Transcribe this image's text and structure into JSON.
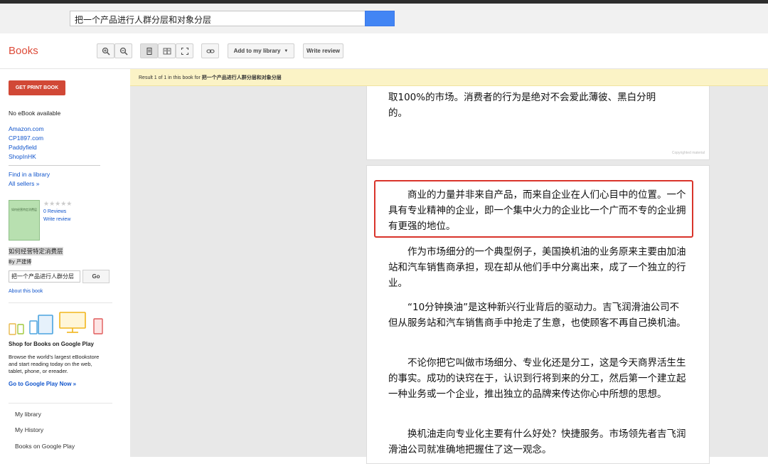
{
  "search": {
    "query": "把一个产品进行人群分层和对象分层"
  },
  "toolbar": {
    "logo": "Books",
    "add_library": "Add to my library",
    "write_review": "Write review"
  },
  "sidebar": {
    "print_button": "GET PRINT BOOK",
    "no_ebook": "No eBook available",
    "sellers": [
      "Amazon.com",
      "CP1897.com",
      "Paddyfield",
      "ShopInHK"
    ],
    "find_library": "Find in a library",
    "all_sellers": "All sellers »",
    "stars": "★★★★★",
    "reviews": "0 Reviews",
    "write_review": "Write review",
    "book_title": "如何经营特定消费层",
    "author": "By 严建博",
    "cover_text": "如何经营特定消费层",
    "insearch_value": "把一个产品进行人群分层",
    "go": "Go",
    "about": "About this book",
    "promo_title": "Shop for Books on Google Play",
    "promo_text_1": "Browse the world's largest eBookstore",
    "promo_text_2": "and start reading today on the web,",
    "promo_text_3": "tablet, phone, or ereader.",
    "promo_link": "Go to Google Play Now »",
    "nav": [
      "My library",
      "My History",
      "Books on Google Play"
    ]
  },
  "result": {
    "prefix": "Result 1 of 1 in this book for ",
    "query": "把一个产品进行人群分层和对象分层"
  },
  "page1": {
    "line1": "取100%的市场。消费者的行为是绝对不会爱此薄彼、黑白分明",
    "line2": "的。",
    "copyright": "Copyrighted material"
  },
  "page2": {
    "p1": "商业的力量并非来自产品，而来自企业在人们心目中的位置。一个具有专业精神的企业，即一个集中火力的企业比一个广而不专的企业拥有更强的地位。",
    "p2": "作为市场细分的一个典型例子，美国换机油的业务原来主要由加油站和汽车销售商承担，现在却从他们手中分离出来，成了一个独立的行业。",
    "p3": "“10分钟换油”是这种新兴行业背后的驱动力。吉飞润滑油公司不但从服务站和汽车销售商手中抢走了生意，也使顾客不再自己换机油。",
    "p4": "不论你把它叫做市场细分、专业化还是分工，这是今天商界活生生的事实。成功的诀窍在于，认识到行将到来的分工，然后第一个建立起一种业务或一个企业，推出独立的品牌来传达你心中所想的思想。",
    "p5": "换机油走向专业化主要有什么好处？快捷服务。市场领先者吉飞润滑油公司就准确地把握住了这一观念。"
  },
  "colors": {
    "accent": "#dd4b39",
    "highlight": "#d9342b",
    "link": "#1155cc",
    "result_bar": "#fbf3c6"
  }
}
